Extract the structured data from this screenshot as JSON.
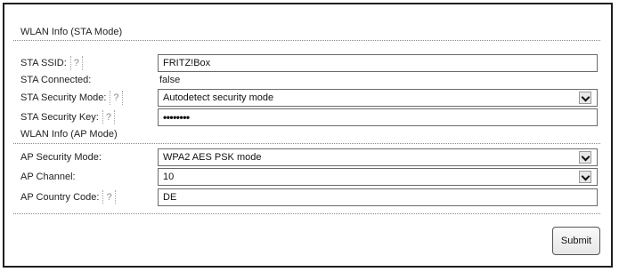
{
  "sta_section": {
    "title": "WLAN Info (STA Mode)",
    "ssid_label": "STA SSID:",
    "ssid_value": "FRITZ!Box",
    "connected_label": "STA Connected:",
    "connected_value": "false",
    "security_mode_label": "STA Security Mode:",
    "security_mode_value": "Autodetect security mode",
    "security_key_label": "STA Security Key:",
    "security_key_value": "••••••••"
  },
  "ap_section": {
    "title": "WLAN Info (AP Mode)",
    "security_mode_label": "AP Security Mode:",
    "security_mode_value": "WPA2 AES PSK mode",
    "channel_label": "AP Channel:",
    "channel_value": "10",
    "country_code_label": "AP Country Code:",
    "country_code_value": "DE"
  },
  "help_glyph": "?",
  "submit_label": "Submit"
}
